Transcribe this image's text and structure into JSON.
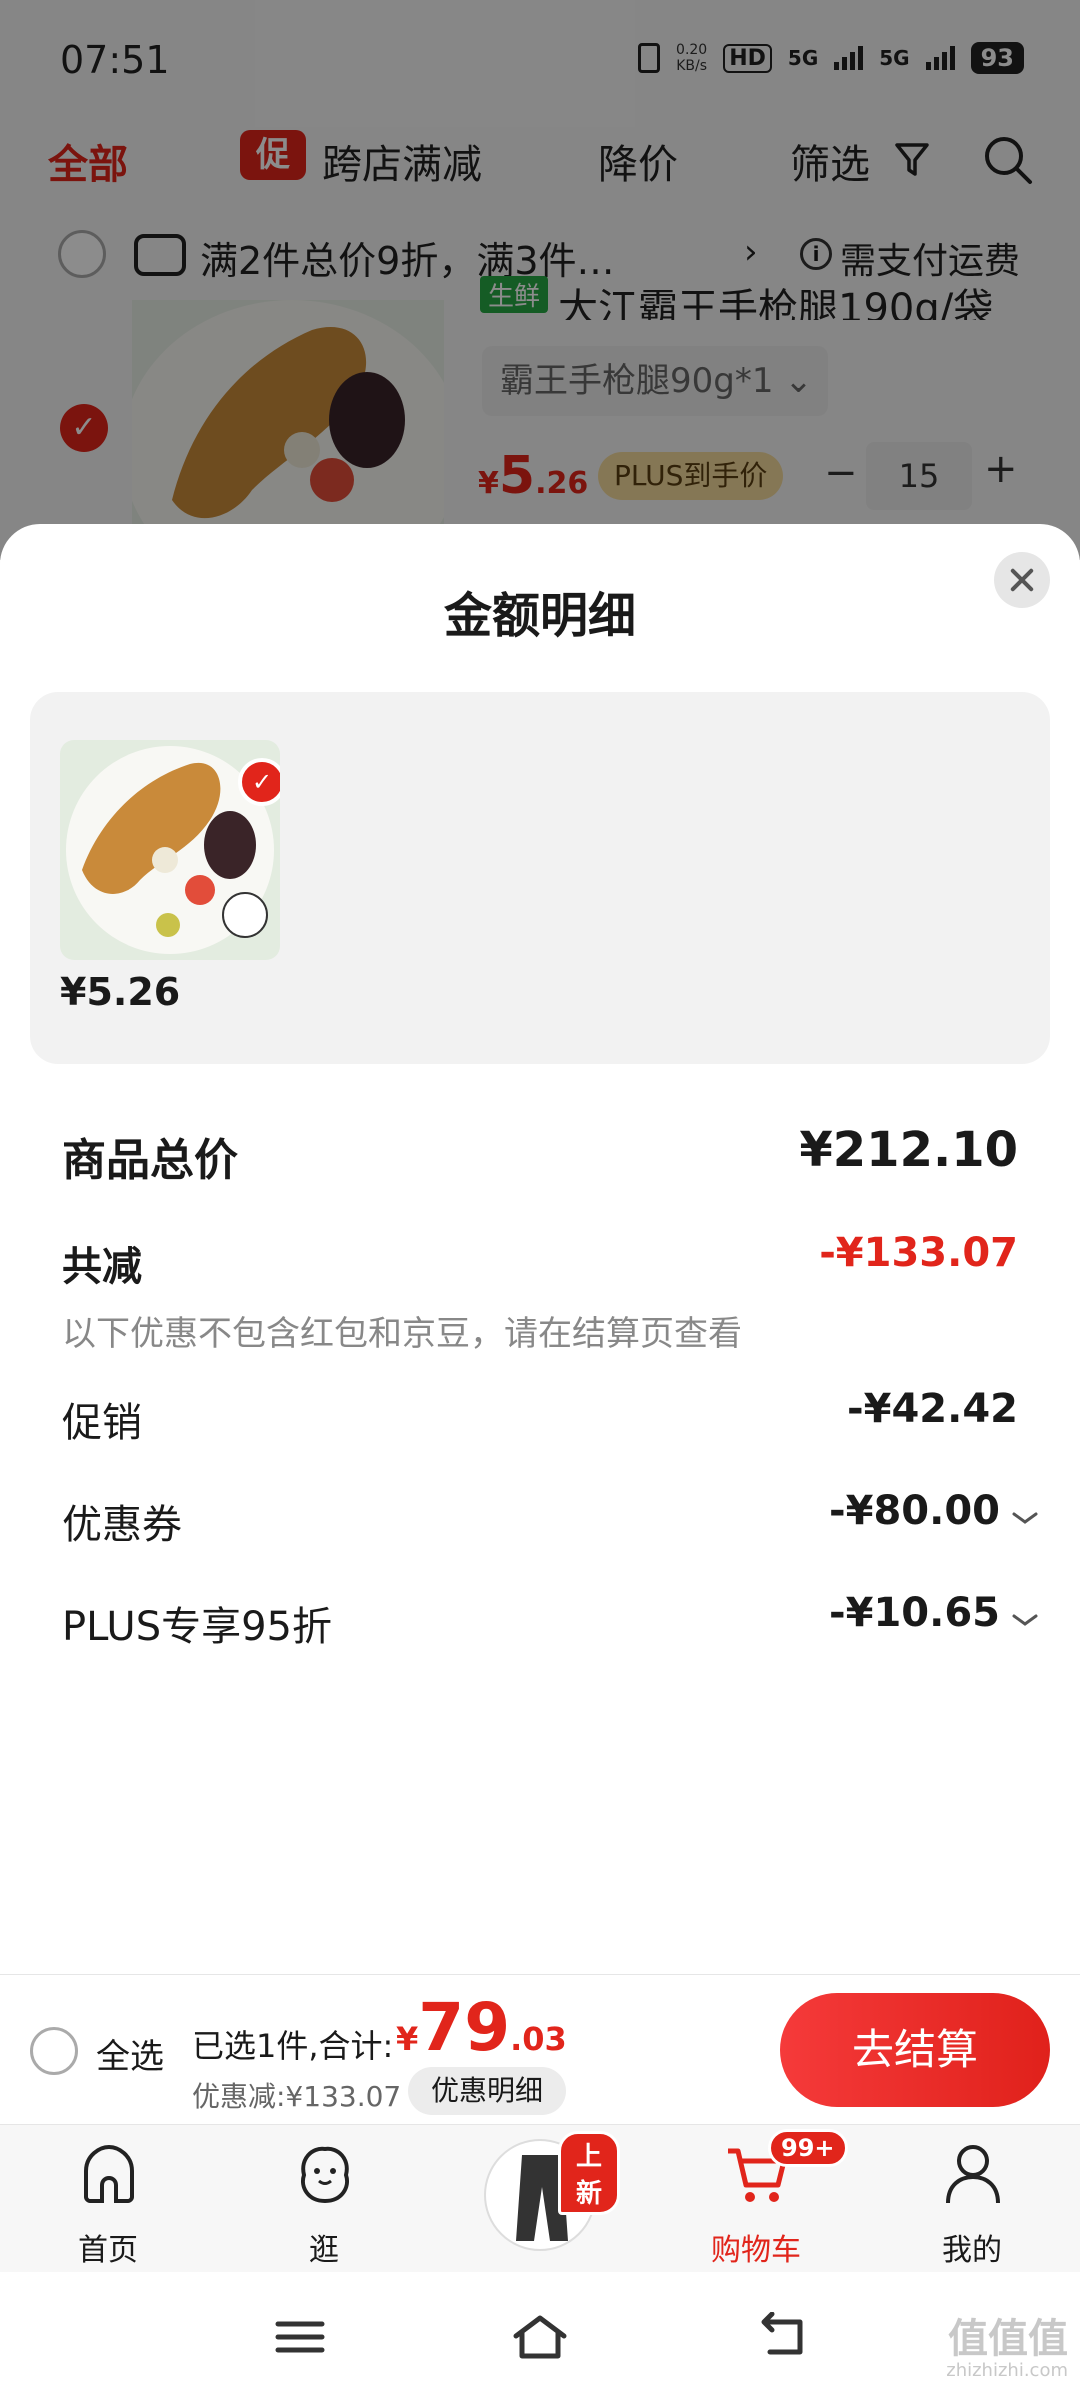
{
  "status_bar": {
    "time": "07:51",
    "speed": "0.20",
    "speed_unit": "KB/s",
    "hd": "HD",
    "network_1": "5G",
    "network_2": "5G",
    "battery": "93"
  },
  "cart_header": {
    "tabs": [
      "全部",
      "跨店满减",
      "降价",
      "筛选"
    ],
    "promo_badge": "促"
  },
  "promo_row": {
    "text": "满2件总价9折，满3件…",
    "arrow": "›",
    "info_icon": "i",
    "shipping_note": "需支付运费"
  },
  "product": {
    "tag": "生鲜",
    "title": "大江霸王手枪腿190g/袋",
    "spec": "霸王手枪腿90g*1 ⌄",
    "price_symbol": "¥",
    "price_int": "5",
    "price_dec": ".26",
    "plus_tag": "PLUS到手价",
    "qty_minus": "−",
    "quantity": "15",
    "qty_plus": "+"
  },
  "sheet": {
    "title": "金额明细",
    "item_price": "¥5.26",
    "total_label": "商品总价",
    "total_value": "¥212.10",
    "reduce_label": "共减",
    "reduce_value": "-¥133.07",
    "note": "以下优惠不包含红包和京豆，请在结算页查看",
    "promo_label": "促销",
    "promo_value": "-¥42.42",
    "coupon_label": "优惠券",
    "coupon_value": "-¥80.00",
    "plus_label": "PLUS专享95折",
    "plus_value": "-¥10.65"
  },
  "checkout": {
    "select_all": "全选",
    "selected_info": "已选1件,合计:",
    "sum_symbol": "¥",
    "sum_int": "79",
    "sum_dec": ".03",
    "discount": "优惠减:¥133.07",
    "detail_chip": "优惠明细",
    "button": "去结算"
  },
  "tab_bar": {
    "home": "首页",
    "explore": "逛",
    "new_badge": "上新",
    "cart": "购物车",
    "cart_badge": "99+",
    "mine": "我的"
  },
  "watermark": {
    "text": "值值值",
    "domain": "zhizhizhi.com"
  },
  "colors": {
    "accent": "#e1251b",
    "plus_gold": "#f2d99c",
    "fresh_green": "#27a844"
  }
}
